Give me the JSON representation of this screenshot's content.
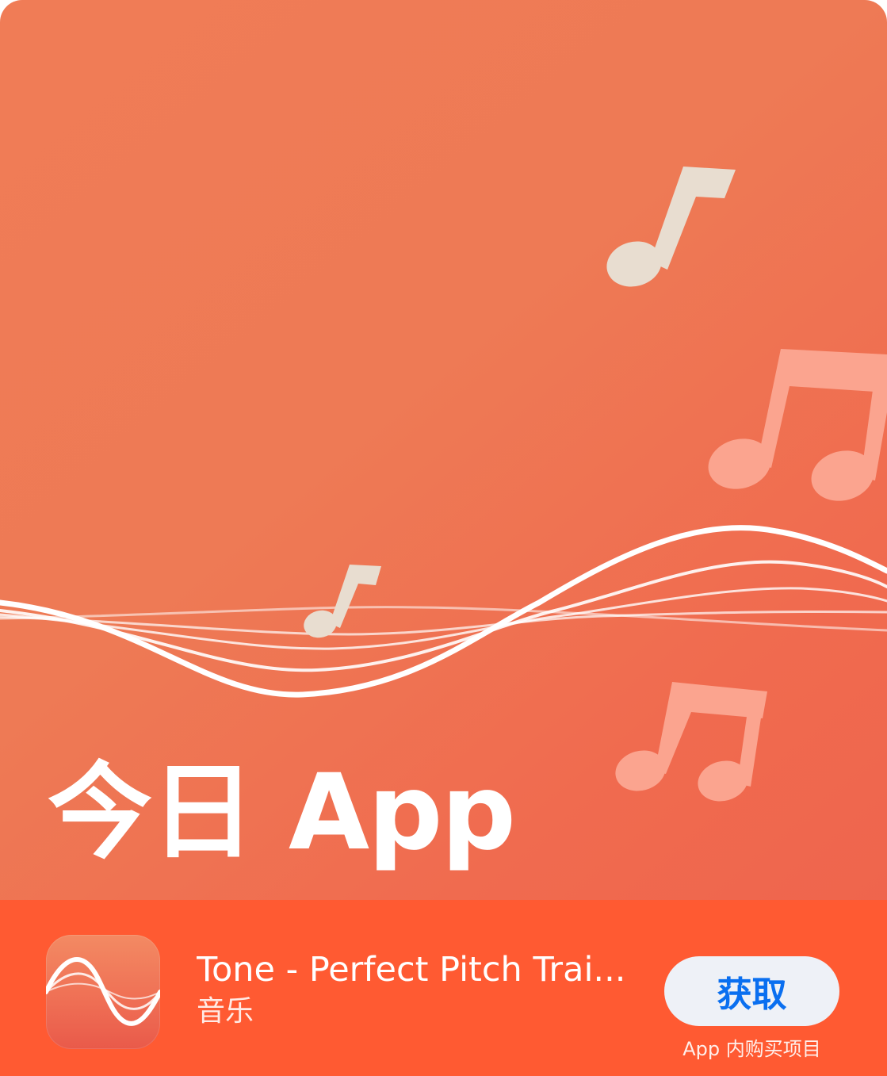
{
  "headline": "今日 App",
  "app": {
    "name": "Tone - Perfect Pitch Trai...",
    "category": "音乐",
    "icon": "sine-wave-icon",
    "get_label": "获取",
    "iap_note": "App 内购买项目"
  },
  "icons": {
    "eighth_note": "eighth-note-icon",
    "beamed_notes": "beamed-notes-icon"
  },
  "colors": {
    "card_background": "#ef7654",
    "bottom_bar": "#ff5a32",
    "button_background": "#eef1f7",
    "button_text": "#0a6ff0",
    "note_cream": "#e8ddd0",
    "note_pink": "#fba48f"
  }
}
